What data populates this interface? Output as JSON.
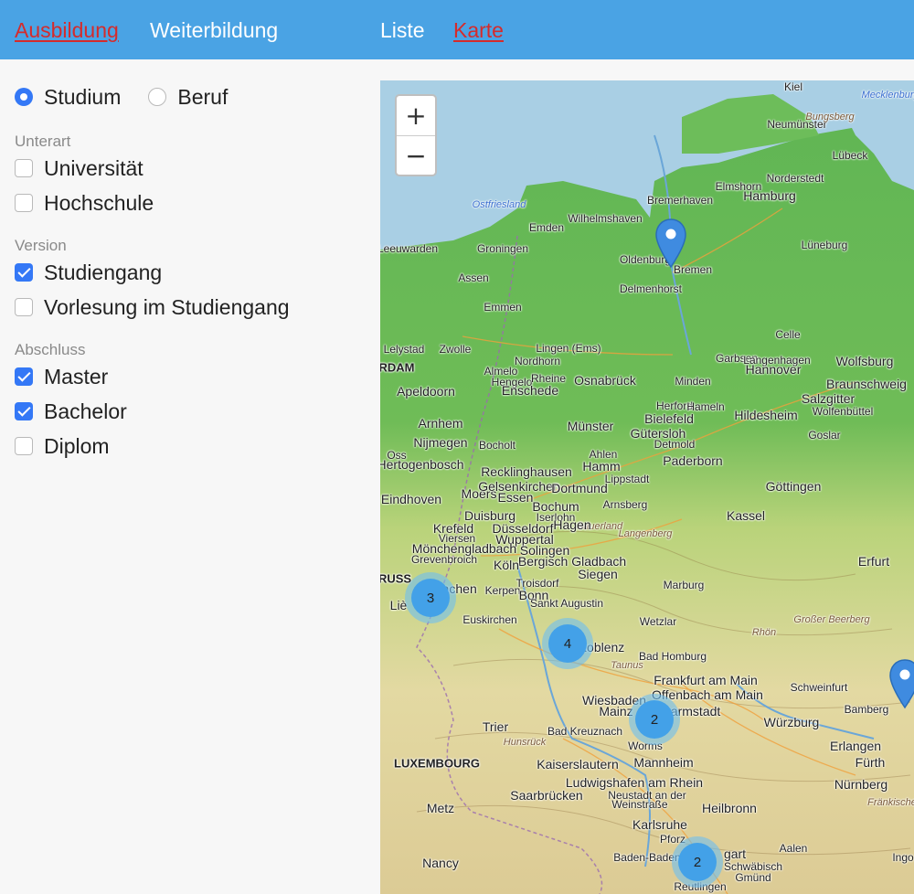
{
  "nav": {
    "ausbildung": "Ausbildung",
    "weiterbildung": "Weiterbildung",
    "liste": "Liste",
    "karte": "Karte"
  },
  "filters": {
    "type": {
      "options": [
        {
          "label": "Studium",
          "selected": true
        },
        {
          "label": "Beruf",
          "selected": false
        }
      ]
    },
    "unterart": {
      "title": "Unterart",
      "items": [
        {
          "label": "Universität",
          "checked": false
        },
        {
          "label": "Hochschule",
          "checked": false
        }
      ]
    },
    "version": {
      "title": "Version",
      "items": [
        {
          "label": "Studiengang",
          "checked": true
        },
        {
          "label": "Vorlesung im Studiengang",
          "checked": false
        }
      ]
    },
    "abschluss": {
      "title": "Abschluss",
      "items": [
        {
          "label": "Master",
          "checked": true
        },
        {
          "label": "Bachelor",
          "checked": true
        },
        {
          "label": "Diplom",
          "checked": false
        }
      ]
    }
  },
  "map": {
    "zoom_in": "+",
    "zoom_out": "−",
    "clusters": [
      {
        "count": "3",
        "near": "Aachen"
      },
      {
        "count": "4",
        "near": "Koblenz"
      },
      {
        "count": "2",
        "near": "Darmstadt"
      },
      {
        "count": "2",
        "near": "Stuttgart"
      }
    ],
    "markers": [
      {
        "near": "Bremen"
      },
      {
        "near": "Bamberg"
      }
    ],
    "labels": {
      "kiel": "Kiel",
      "mecklenburg": "Mecklenburger",
      "neumunster": "Neumünster",
      "bungsberg": "Bungsberg",
      "lubeck": "Lübeck",
      "norderstedt": "Norderstedt",
      "hamburg": "Hamburg",
      "bremerhaven": "Bremerhaven",
      "elmshorn": "Elmshorn",
      "emden": "Emden",
      "wilhelmshaven": "Wilhelmshaven",
      "leeuwarden": "Leeuwarden",
      "groningen": "Groningen",
      "oldenburg": "Oldenburg",
      "bremen": "Bremen",
      "delmenhorst": "Delmenhorst",
      "luneburg": "Lüneburg",
      "assen": "Assen",
      "emmen": "Emmen",
      "celle": "Celle",
      "lelystad": "Lelystad",
      "zwolle": "Zwolle",
      "lingen": "Lingen (Ems)",
      "nordhorn": "Nordhorn",
      "garbsen": "Garbsen",
      "langenhagen": "Langenhagen",
      "wolfsburg": "Wolfsburg",
      "rdam": "RDAM",
      "almelo": "Almelo",
      "hengelo": "Hengelo",
      "rheine": "Rheine",
      "osnabruck": "Osnabrück",
      "minden": "Minden",
      "hannover": "Hannover",
      "braunschweig": "Braunschweig",
      "apeldoorn": "Apeldoorn",
      "enschede": "Enschede",
      "salzgitter": "Salzgitter",
      "wolfenbuttel": "Wolfenbüttel",
      "herford": "Herford",
      "hameln": "Hameln",
      "bielefeld": "Bielefeld",
      "hildesheim": "Hildesheim",
      "arnhem": "Arnhem",
      "munster": "Münster",
      "nijmegen": "Nijmegen",
      "gutersloh": "Gütersloh",
      "detmold": "Detmold",
      "goslar": "Goslar",
      "bocholt": "Bocholt",
      "ahlen": "Ahlen",
      "oss": "Oss",
      "hertogenbosch": "Hertogenbosch",
      "hamm": "Hamm",
      "paderborn": "Paderborn",
      "recklinghausen": "Recklinghausen",
      "lippstadt": "Lippstadt",
      "eindhoven": "Eindhoven",
      "moers": "Moers",
      "gelsenkirchen": "Gelsenkirchen",
      "essen": "Essen",
      "dortmund": "Dortmund",
      "bochum": "Bochum",
      "gottingen": "Göttingen",
      "arnsberg": "Arnsberg",
      "duisburg": "Duisburg",
      "iserlohn": "Iserlohn",
      "kassel": "Kassel",
      "sauerland": "Sauerland",
      "krefeld": "Krefeld",
      "dusseldorf": "Düsseldorf",
      "hagen": "Hagen",
      "langenberg": "Langenberg",
      "viersen": "Viersen",
      "wuppertal": "Wuppertal",
      "monchengladbach": "Mönchengladbach",
      "solingen": "Solingen",
      "bergisch": "Bergisch Gladbach",
      "grevenbroich": "Grevenbroich",
      "erfurt": "Erfurt",
      "koln": "Köln",
      "siegen": "Siegen",
      "russ": "RUSS",
      "troisdorf": "Troisdorf",
      "aachen": "Aachen",
      "kerpen": "Kerpen",
      "bonn": "Bonn",
      "marburg": "Marburg",
      "sankt_augustin": "Sankt Augustin",
      "lie": "Liè",
      "euskirchen": "Euskirchen",
      "rhon": "Rhön",
      "beerberg": "Großer Beerberg",
      "wetzlar": "Wetzlar",
      "giessen": "Gießen",
      "koblenz": "Koblenz",
      "taunus": "Taunus",
      "bad_homburg": "Bad Homburg",
      "frankfurt": "Frankfurt am Main",
      "offenbach": "Offenbach am Main",
      "schweinfurt": "Schweinfurt",
      "wiesbaden": "Wiesbaden",
      "mainz": "Mainz",
      "darmstadt": "Darmstadt",
      "bamberg": "Bamberg",
      "trier": "Trier",
      "hunsruck": "Hunsrück",
      "bad_kreuznach": "Bad Kreuznach",
      "wurzburg": "Würzburg",
      "luxembourg": "LUXEMBOURG",
      "worms": "Worms",
      "erlangen": "Erlangen",
      "kaiserslautern": "Kaiserslautern",
      "mannheim": "Mannheim",
      "furth": "Fürth",
      "ludwigshafen": "Ludwigshafen am Rhein",
      "nurnberg": "Nürnberg",
      "neustadt": "Neustadt an der",
      "weinstrasse": "Weinstraße",
      "saarbrucken": "Saarbrücken",
      "heilbronn": "Heilbronn",
      "frankische": "Fränkische",
      "metz": "Metz",
      "karlsruhe": "Karlsruhe",
      "pforzheim": "Pforz",
      "stuttgart": "gart",
      "aalen": "Aalen",
      "nancy": "Nancy",
      "baden_baden": "Baden-Baden",
      "schwabisch": "Schwäbisch",
      "gmund": "Gmünd",
      "reutlingen": "Reutlingen",
      "ingo": "Ingo",
      "ostfriesland": "Ostfriesland"
    }
  }
}
